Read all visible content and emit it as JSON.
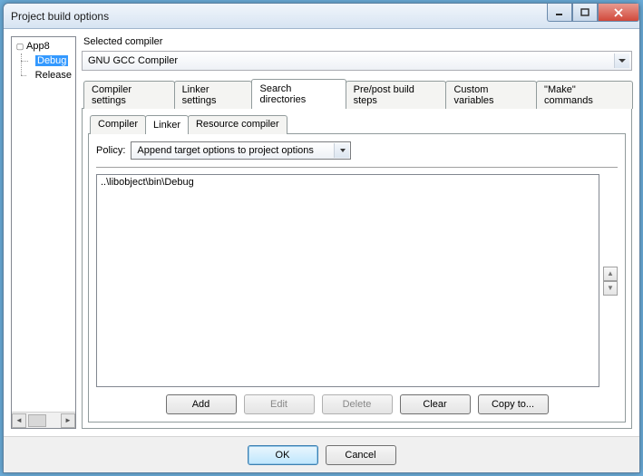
{
  "window": {
    "title": "Project build options"
  },
  "tree": {
    "root": "App8",
    "children": [
      "Debug",
      "Release"
    ],
    "selected": "Debug"
  },
  "compiler": {
    "label": "Selected compiler",
    "value": "GNU GCC Compiler"
  },
  "tabs": {
    "items": [
      "Compiler settings",
      "Linker settings",
      "Search directories",
      "Pre/post build steps",
      "Custom variables",
      "\"Make\" commands"
    ],
    "active": "Search directories"
  },
  "subtabs": {
    "items": [
      "Compiler",
      "Linker",
      "Resource compiler"
    ],
    "active": "Linker"
  },
  "policy": {
    "label": "Policy:",
    "value": "Append target options to project options"
  },
  "directories": {
    "items": [
      "..\\libobject\\bin\\Debug"
    ]
  },
  "buttons": {
    "add": "Add",
    "edit": "Edit",
    "delete": "Delete",
    "clear": "Clear",
    "copy": "Copy to..."
  },
  "footer": {
    "ok": "OK",
    "cancel": "Cancel"
  }
}
